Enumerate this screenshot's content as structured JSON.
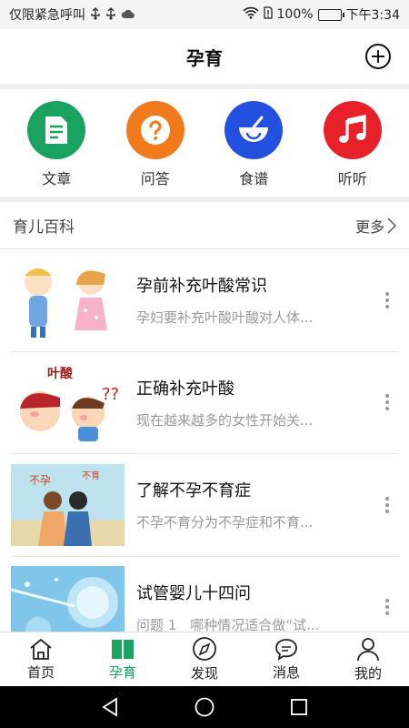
{
  "status_bar": {
    "left_text": "仅限紧急呼叫",
    "left_icons": [
      "usb-icon",
      "usb-icon",
      "cloud-icon"
    ],
    "battery_percent": "100%",
    "battery_level": 1.0,
    "time": "下午3:34"
  },
  "header": {
    "title": "孕育"
  },
  "shortcuts": [
    {
      "label": "文章",
      "icon": "article-icon",
      "color": "#1aa260"
    },
    {
      "label": "问答",
      "icon": "question-icon",
      "color": "#f07a1c"
    },
    {
      "label": "食谱",
      "icon": "bowl-icon",
      "color": "#2450e0"
    },
    {
      "label": "听听",
      "icon": "music-icon",
      "color": "#e8202a"
    }
  ],
  "section": {
    "title": "育儿百科",
    "more_label": "更多"
  },
  "articles": [
    {
      "title": "孕前补充叶酸常识",
      "desc": "孕妇要补充叶酸叶酸对人体..."
    },
    {
      "title": "正确补充叶酸",
      "desc": "现在越来越多的女性开始关...",
      "thumb_text": "叶酸"
    },
    {
      "title": "了解不孕不育症",
      "desc": "不孕不育分为不孕症和不育...",
      "thumb_text": "不孕",
      "thumb_text2": "不育"
    },
    {
      "title": "试管婴儿十四问",
      "desc": "问题 1　哪种情况适合做“试..."
    }
  ],
  "tabs": [
    {
      "label": "首页",
      "icon": "home-icon",
      "active": false
    },
    {
      "label": "孕育",
      "icon": "book-icon",
      "active": true
    },
    {
      "label": "发现",
      "icon": "compass-icon",
      "active": false
    },
    {
      "label": "消息",
      "icon": "message-icon",
      "active": false
    },
    {
      "label": "我的",
      "icon": "profile-icon",
      "active": false
    }
  ],
  "colors": {
    "accent": "#1aa260",
    "divider": "#eeeeee"
  }
}
